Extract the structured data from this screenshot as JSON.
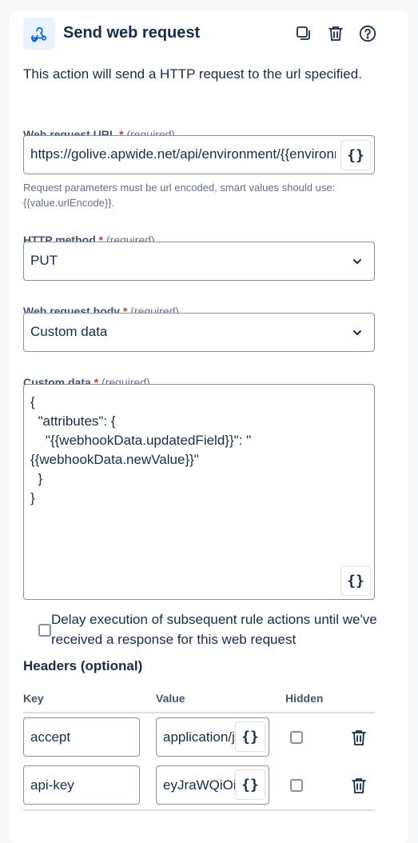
{
  "header": {
    "title": "Send web request",
    "app_icon": "webhook-icon",
    "actions": [
      "duplicate-icon",
      "trash-icon",
      "help-icon"
    ]
  },
  "description": "This action will send a HTTP request to the url specified.",
  "url_field": {
    "label": "Web request URL",
    "required_mark": "*",
    "required_text": "(required)",
    "value": "https://golive.apwide.net/api/environment/{{environmentId}}",
    "helper": "Request parameters must be url encoded, smart values should use: {{value.urlEncode}}."
  },
  "smart_value_glyph": "{}",
  "method_field": {
    "label": "HTTP method",
    "required_mark": "*",
    "required_text": "(required)",
    "value": "PUT"
  },
  "body_field": {
    "label": "Web request body",
    "required_mark": "*",
    "required_text": "(required)",
    "value": "Custom data"
  },
  "custom_data": {
    "label": "Custom data",
    "required_mark": "*",
    "required_text": "(required)",
    "value": "{\n  \"attributes\": {\n    \"{{webhookData.updatedField}}\": \"{{webhookData.newValue}}\"\n  }\n}"
  },
  "delay_option": {
    "label": "Delay execution of subsequent rule actions until we've received a response for this web request",
    "checked": false
  },
  "headers": {
    "title": "Headers (optional)",
    "columns": {
      "key": "Key",
      "value": "Value",
      "hidden": "Hidden"
    },
    "rows": [
      {
        "key": "accept",
        "value": "application/json",
        "hidden": false
      },
      {
        "key": "api-key",
        "value": "eyJraWQiOi",
        "hidden": false
      }
    ]
  },
  "colors": {
    "accent": "#0c66e4",
    "required": "#c9372c",
    "border": "#8590a2"
  }
}
